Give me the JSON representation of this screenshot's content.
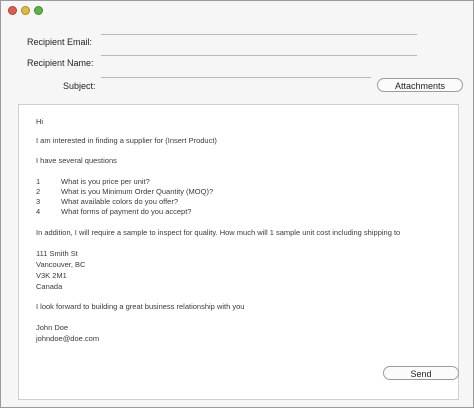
{
  "form": {
    "recipient_email_label": "Recipient Email:",
    "recipient_name_label": "Recipient Name:",
    "subject_label": "Subject:",
    "recipient_email_value": "",
    "recipient_name_value": "",
    "subject_value": "",
    "attachments_label": "Attachments"
  },
  "message": {
    "greeting": "Hi",
    "intro": "I am interested in finding a supplier for (Insert Product)",
    "questions_intro": "I have several questions",
    "questions": [
      {
        "num": "1",
        "text": "What is you price per unit?"
      },
      {
        "num": "2",
        "text": "What is you Minimum Order Quantity (MOQ)?"
      },
      {
        "num": "3",
        "text": "What available colors do you offer?"
      },
      {
        "num": "4",
        "text": "What forms of payment do you accept?"
      }
    ],
    "sample_request": "In addition, I will require a sample to inspect for quality. How much will 1 sample unit cost including shipping to",
    "address": [
      "111 Smith St",
      "Vancouver, BC",
      "V3K 2M1",
      "Canada"
    ],
    "closing": "I look forward to building a great business relationship with you",
    "sender_name": "John Doe",
    "sender_email": "johndoe@doe.com"
  },
  "actions": {
    "send_label": "Send"
  },
  "colors": {
    "close": "#e25b4f",
    "minimize": "#e4b93a",
    "maximize": "#5ab544"
  }
}
